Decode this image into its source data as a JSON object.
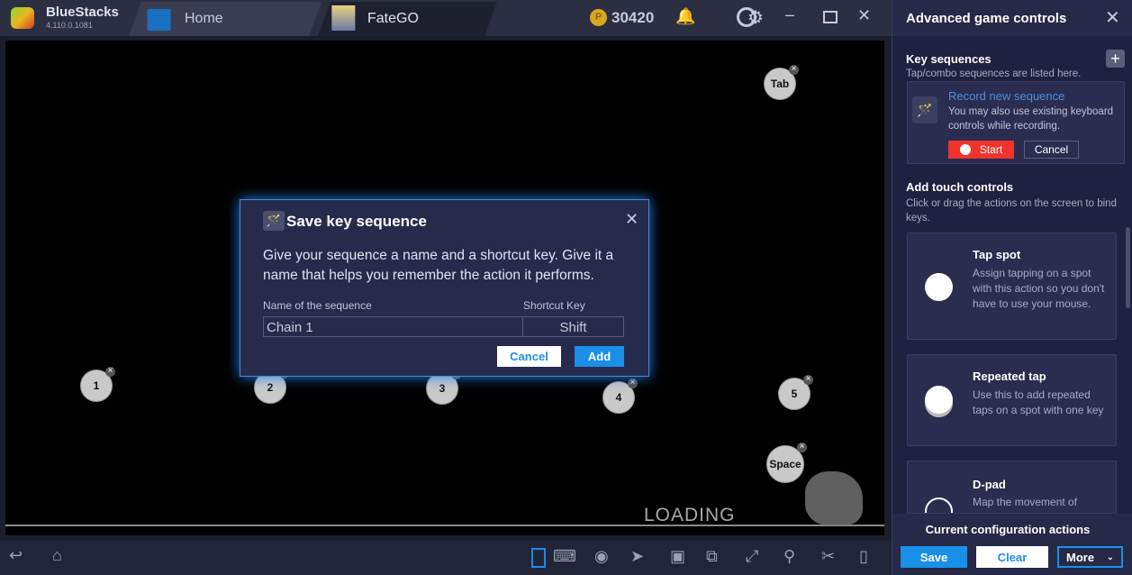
{
  "titlebar": {
    "app_name": "BlueStacks",
    "version": "4.110.0.1081",
    "tabs": [
      {
        "label": "Home",
        "icon": "home-icon"
      },
      {
        "label": "FateGO",
        "icon": "game-thumbnail"
      }
    ],
    "coins": "30420"
  },
  "game": {
    "keys": [
      "Tab",
      "1",
      "2",
      "3",
      "4",
      "5",
      "Space"
    ],
    "loading": "LOADING"
  },
  "dialog": {
    "title": "Save key sequence",
    "description": "Give your sequence a name and a shortcut key. Give it a name that helps you remember the action it performs.",
    "name_label": "Name of the sequence",
    "shortcut_label": "Shortcut Key",
    "name_value": "Chain 1",
    "shortcut_value": "Shift",
    "cancel": "Cancel",
    "add": "Add"
  },
  "panel": {
    "title": "Advanced game controls",
    "key_sequences": {
      "title": "Key sequences",
      "subtitle": "Tap/combo sequences are listed here.",
      "record_title": "Record new sequence",
      "record_desc": "You may also use existing keyboard controls while recording.",
      "start": "Start",
      "cancel": "Cancel"
    },
    "touch": {
      "title": "Add touch controls",
      "subtitle": "Click or drag the actions on the screen to bind keys.",
      "cards": [
        {
          "title": "Tap spot",
          "desc": "Assign tapping on a spot with this action so you don't have to use your mouse."
        },
        {
          "title": "Repeated tap",
          "desc": "Use this to add repeated taps on a spot with one key"
        },
        {
          "title": "D-pad",
          "desc": "Map the movement of"
        }
      ]
    },
    "footer": {
      "title": "Current configuration actions",
      "save": "Save",
      "clear": "Clear",
      "more": "More"
    }
  },
  "colors": {
    "accent": "#1a8fe8",
    "start": "#f0342c",
    "link": "#4a8ee0"
  }
}
